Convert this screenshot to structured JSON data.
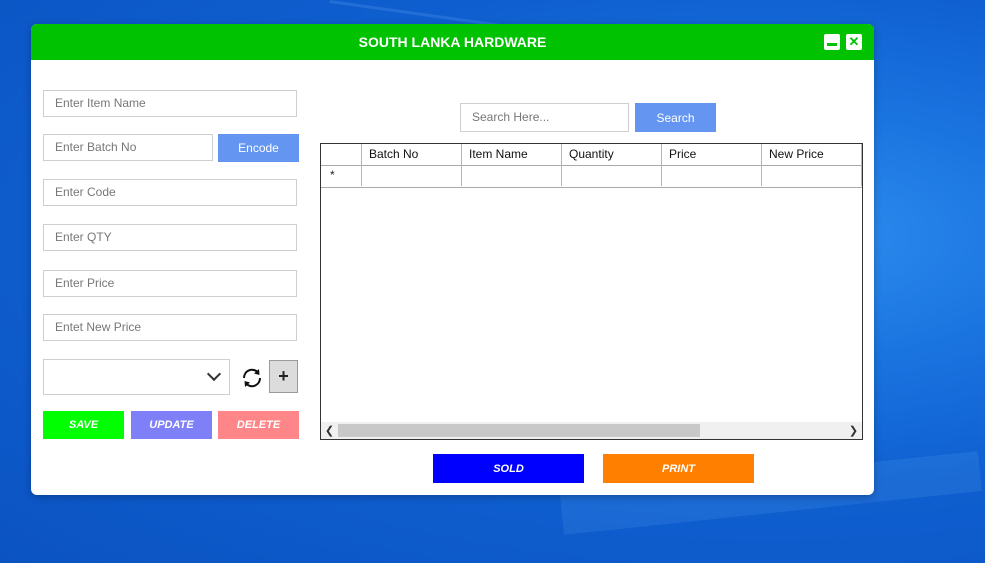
{
  "app": {
    "title": "SOUTH LANKA HARDWARE",
    "window_buttons": {
      "minimize_icon": "minimize-icon",
      "close_icon": "close-icon",
      "close_glyph": "✕"
    }
  },
  "form": {
    "item_name_placeholder": "Enter Item Name",
    "batch_no_placeholder": "Enter Batch No",
    "code_placeholder": "Enter Code",
    "qty_placeholder": "Enter QTY",
    "price_placeholder": "Enter Price",
    "new_price_placeholder": "Entet New Price",
    "encode_label": "Encode",
    "combo_value": "",
    "add_label": "+",
    "save_label": "SAVE",
    "update_label": "UPDATE",
    "delete_label": "DELETE"
  },
  "search": {
    "placeholder": "Search Here...",
    "button_label": "Search"
  },
  "grid": {
    "columns": [
      "Batch No",
      "Item Name",
      "Quantity",
      "Price",
      "New Price"
    ],
    "new_row_marker": "*",
    "rows": []
  },
  "footer": {
    "sold_label": "SOLD",
    "print_label": "PRINT"
  },
  "colors": {
    "titlebar": "#00c200",
    "encode": "#6495f0",
    "save": "#00ff00",
    "update": "#7f80f8",
    "delete": "#ff8688",
    "sold": "#0000ff",
    "print": "#ff7f00"
  }
}
